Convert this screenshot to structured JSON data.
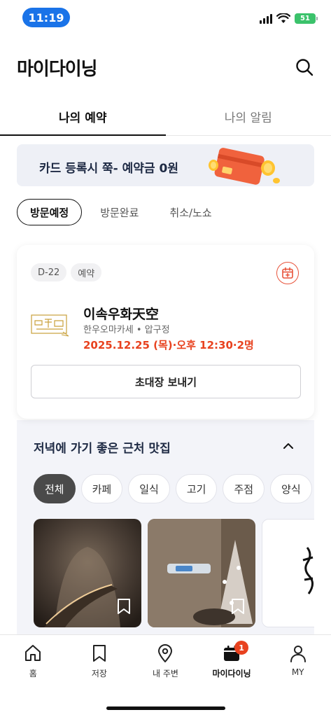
{
  "status_bar": {
    "time": "11:19",
    "battery": "51"
  },
  "header": {
    "title": "마이다이닝"
  },
  "main_tabs": [
    {
      "label": "나의 예약",
      "active": true
    },
    {
      "label": "나의 알림",
      "active": false
    }
  ],
  "banner": {
    "text": "카드 등록시 쭉- 예약금 0원"
  },
  "filters": [
    {
      "label": "방문예정",
      "active": true
    },
    {
      "label": "방문완료",
      "active": false
    },
    {
      "label": "취소/노쇼",
      "active": false
    }
  ],
  "reservation": {
    "tags": [
      "D-22",
      "예약"
    ],
    "name": "이속우화天空",
    "meta": "한우오마카세 • 압구정",
    "datetime": "2025.12.25 (목)·오후 12:30·2명",
    "invite_label": "초대장 보내기"
  },
  "nearby": {
    "title": "저녁에 가기 좋은 근처 맛집",
    "categories": [
      {
        "label": "전체",
        "active": true
      },
      {
        "label": "카페",
        "active": false
      },
      {
        "label": "일식",
        "active": false
      },
      {
        "label": "고기",
        "active": false
      },
      {
        "label": "주점",
        "active": false
      },
      {
        "label": "양식",
        "active": false
      }
    ]
  },
  "bottom_nav": [
    {
      "label": "홈",
      "icon": "home-icon"
    },
    {
      "label": "저장",
      "icon": "bookmark-icon"
    },
    {
      "label": "내 주변",
      "icon": "location-pin-icon"
    },
    {
      "label": "마이다이닝",
      "icon": "calendar-icon",
      "active": true,
      "badge": "1"
    },
    {
      "label": "MY",
      "icon": "person-icon"
    }
  ],
  "colors": {
    "accent": "#e8421f",
    "status_pill": "#1a73e8",
    "battery": "#3bc26b"
  }
}
